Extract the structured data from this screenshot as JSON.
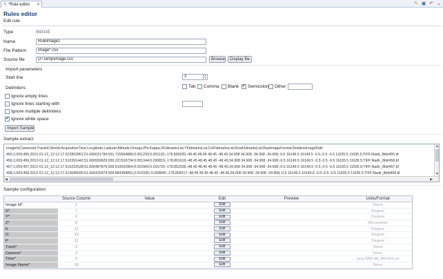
{
  "tab": {
    "label": "*Rule editor",
    "close": "✕"
  },
  "toolbar_icons": [
    "pencil-icon",
    "save-icon",
    "undo-icon",
    "chevron-down-icon"
  ],
  "title": "Rules editor",
  "subtitle": "Edit rule",
  "form": {
    "type_label": "Type",
    "type_value": "IMAGE",
    "name_label": "Name",
    "name_value": "RuleImage1",
    "file_pattern_label": "File Pattern",
    "file_pattern_value": "image*.csv",
    "source_file_label": "Source file",
    "source_file_value": "D:\\Temp\\image.csv",
    "browse_label": "Browse",
    "display_file_label": "Display file"
  },
  "import_params": {
    "title": "Import parameters",
    "start_line_label": "Start line",
    "start_line_value": "2",
    "delimiters_label": "Delimiters",
    "delimiters": [
      {
        "label": "Tab",
        "checked": false
      },
      {
        "label": "Comma",
        "checked": false
      },
      {
        "label": "Blank",
        "checked": false
      },
      {
        "label": "Semicolon",
        "checked": true
      },
      {
        "label": "Other",
        "checked": false
      }
    ],
    "ignore_empty_label": "Ignore empty lines",
    "ignore_empty_checked": false,
    "ignore_starting_label": "Ignore lines starting with",
    "ignore_starting_checked": false,
    "ignore_multiple_label": "Ignore multiple delimiters",
    "ignore_multiple_checked": false,
    "ignore_white_label": "Ignore white space",
    "ignore_white_checked": true,
    "import_sample_label": "Import Sample"
  },
  "sample_extract": {
    "title": "Sample extract",
    "lines": [
      "ImageId;CameraId;TrackId;ShotId;AcquisitionTime;Longitude;Latitude;Altitude;Omega;Phi;Kappa;XFidmarksList;YFidmarksList;ColFidmarksList;RowFidmarksList;RawImageFormat;RelativeImagePath",
      "455;1;009;455;2012-01-12_12:12:17.522852861;51.606631784;931.715564886;0.001293;0.001132;-178.836935;-48.45 48.45 48.45 -48.45;34.908 34.908 -34.908 -34.908;-0.5 16149.5 16149.5 -0.5;-0.5 -0.5 11635.5 11635.5;TIFF;Nadir_8bit/455.tif",
      "456;1;009;456;2012-01-12_12:12:17.510391442;51.606559929;930.221518734;0.001344;0.030819;-178.801619;-48.45 48.45 48.45 -48.45;34.908 34.908 -34.908 -34.908;-0.5 16149.5 16149.5 -0.5;-0.5 -0.5 11635.5 11635.5;TIFF;Nadir_8bit/456.tif",
      "457;1;009;457;2012-01-12_12:12:17.516222528;51.606487876;928.919520964;0.022966;0.016725;-178.852936;-48.45 48.45 48.45 -48.45;34.908 34.908 -34.908 -34.908;-0.5 16149.5 16149.5 -0.5;-0.5 -0.5 11635.5 11635.5;TIFF;Nadir_8bit/457.tif",
      "458;1;009;458;2012-01-12_12:12:17.513046695;51.606415974;928.884358861;0.010336;-0.008845;-178.809317;-48.45 48.45 48.45 -48.45;34.908 34.908 -34.908 -34.908;-0.5 16149.5 16149.5 -0.5;-0.5 -0.5 11635.5 11635.5;TIFF;Nadir_8bit/458.tif",
      "459;1;009;459;2012-01-12_12:12:17.509759157;51.606343683;928.288204120;0.010390;-0.001063;-178.767941;-48.45 48.45 48.45 -48.45;34.908 34.908 -34.908 -34.908;-0.5 16149.5 16149.5 -0.5;-0.5 -0.5 11635.5 11635.5;TIFF;Nadir_8bit/459.tif"
    ]
  },
  "sample_config": {
    "title": "Sample configuration",
    "headers": {
      "name": "",
      "source": "Source Column",
      "value": "Value",
      "edit": "Edit",
      "preview": "Preview",
      "units": "Units/Format"
    },
    "edit_label": "Edit",
    "rows": [
      {
        "name": "Image Id*",
        "source": "1",
        "units": "None"
      },
      {
        "name": "X*",
        "source": "7",
        "units": "Degree"
      },
      {
        "name": "Y*",
        "source": "6",
        "units": "Degree"
      },
      {
        "name": "Z*",
        "source": "8",
        "units": "Micrometer"
      },
      {
        "name": "K",
        "source": "11",
        "units": "Degree"
      },
      {
        "name": "O",
        "source": "10",
        "units": "Degree"
      },
      {
        "name": "P",
        "source": "11",
        "units": "Degree"
      },
      {
        "name": "Track*",
        "source": "3",
        "units": "None"
      },
      {
        "name": "Camera*",
        "source": "2",
        "units": "None"
      },
      {
        "name": "Time*",
        "source": "5",
        "units": "yyyy-MM-dd_HH:mm:ss"
      },
      {
        "name": "Image Name*",
        "source": "18",
        "units": "None"
      }
    ]
  },
  "colors": {
    "title": "#1a3e78",
    "accent": "#5577aa"
  }
}
